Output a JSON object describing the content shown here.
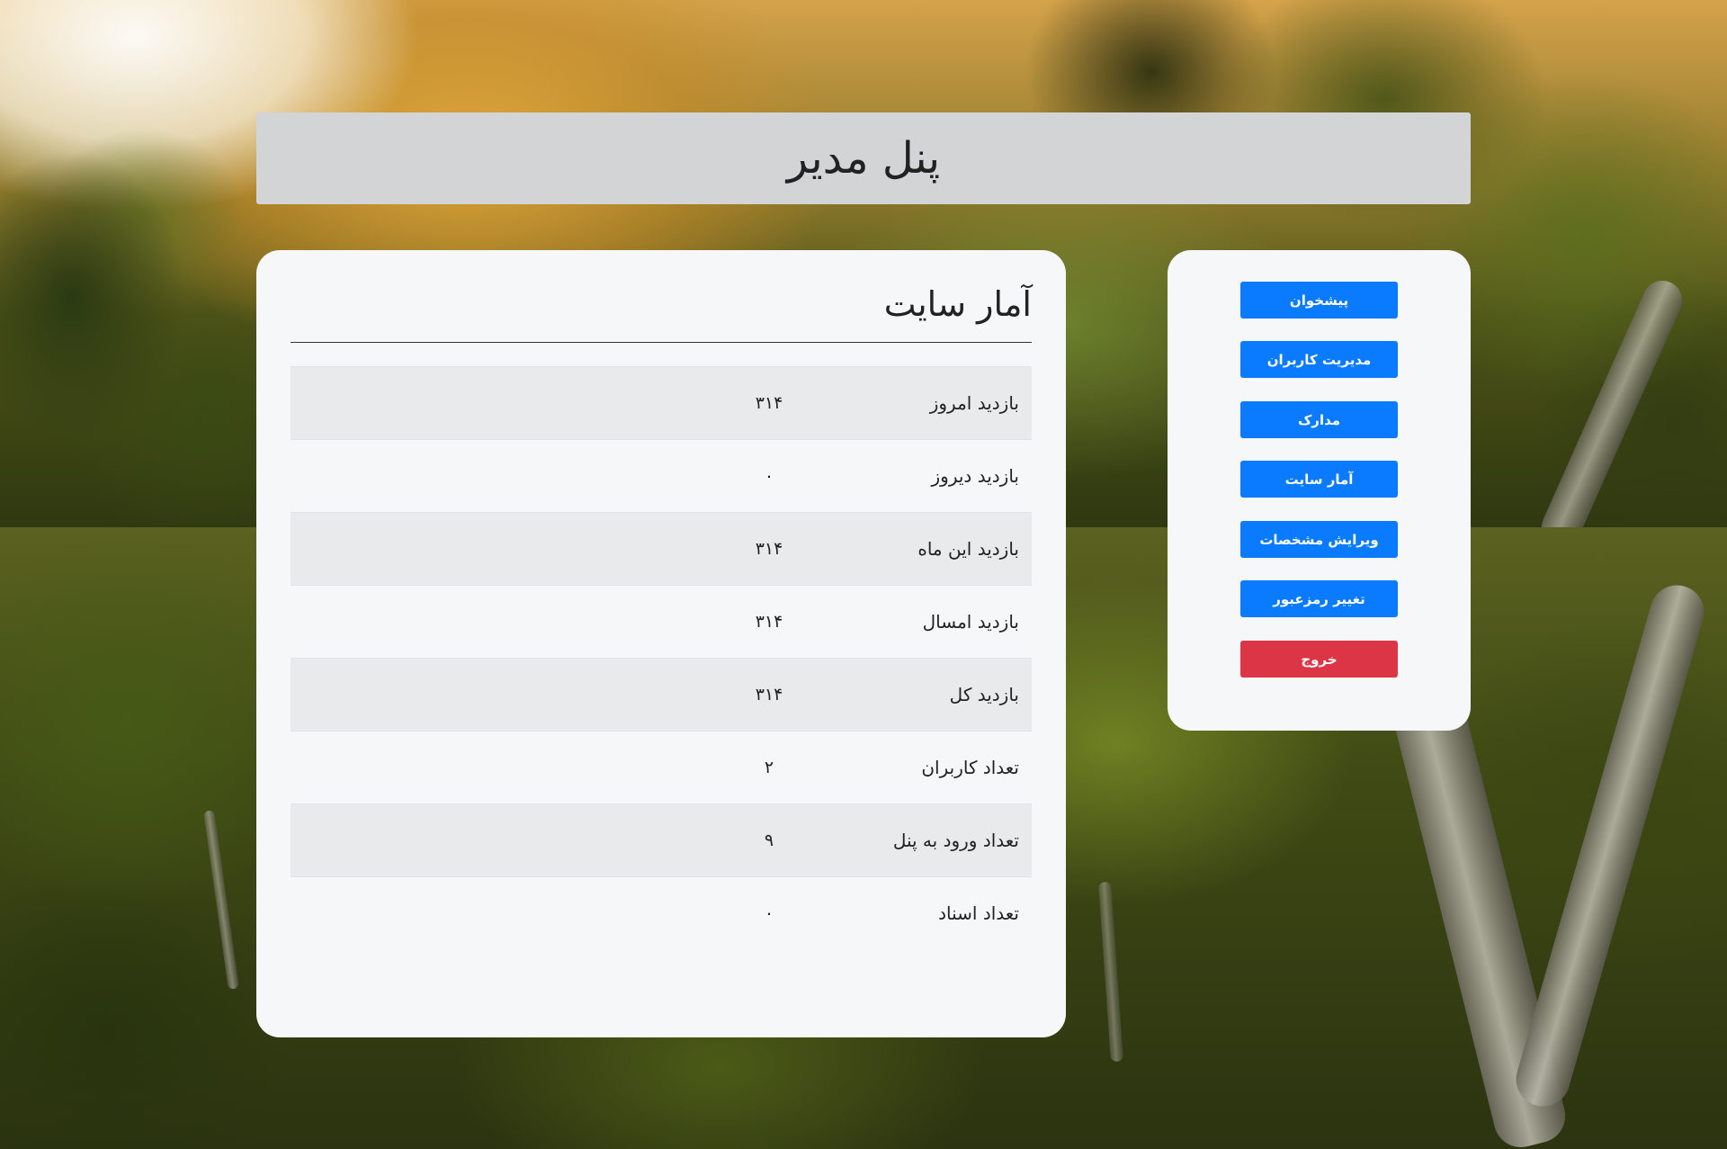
{
  "header": {
    "title": "پنل مدیر"
  },
  "stats": {
    "title": "آمار سایت",
    "rows": [
      {
        "label": "بازدید امروز",
        "value": "۳۱۴"
      },
      {
        "label": "بازدید دیروز",
        "value": "۰"
      },
      {
        "label": "بازدید این ماه",
        "value": "۳۱۴"
      },
      {
        "label": "بازدید امسال",
        "value": "۳۱۴"
      },
      {
        "label": "بازدید کل",
        "value": "۳۱۴"
      },
      {
        "label": "تعداد کاربران",
        "value": "۲"
      },
      {
        "label": "تعداد ورود به پنل",
        "value": "۹"
      },
      {
        "label": "تعداد اسناد",
        "value": "۰"
      }
    ]
  },
  "sidebar": {
    "items": [
      {
        "label": "پیشخوان"
      },
      {
        "label": "مدیریت کاربران"
      },
      {
        "label": "مدارک"
      },
      {
        "label": "آمار سایت"
      },
      {
        "label": "ویرایش مشخصات"
      },
      {
        "label": "تغییر رمزعبور"
      },
      {
        "label": "خروج"
      }
    ]
  },
  "colors": {
    "primary_button": "#0a7bff",
    "danger_button": "#dc3545",
    "header_bg": "#d3d4d6",
    "card_bg": "#f6f7f9",
    "striped_row_bg": "#e9eaec"
  },
  "background": {
    "description_icon": "forest-photo"
  }
}
